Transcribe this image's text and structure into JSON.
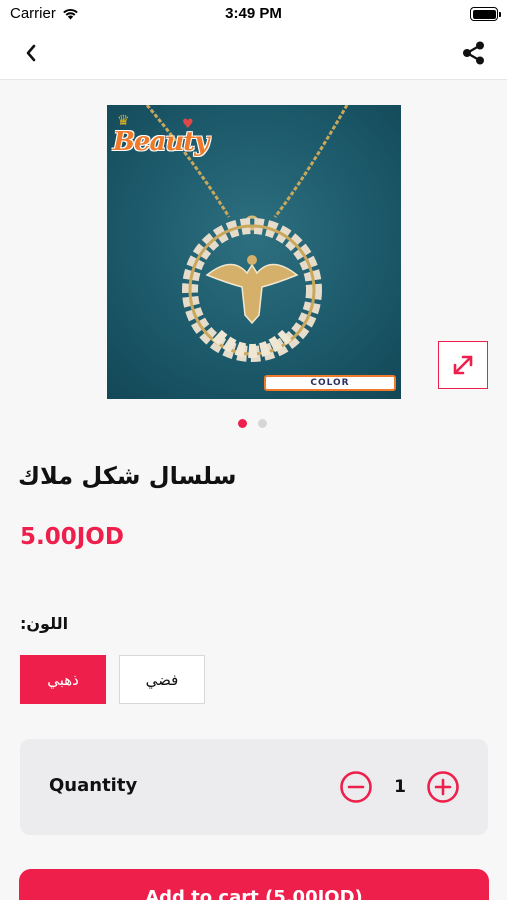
{
  "status_bar": {
    "carrier": "Carrier",
    "time": "3:49 PM"
  },
  "nav": {
    "back_icon": "chevron-left-icon",
    "share_icon": "share-icon"
  },
  "product": {
    "image_brand": "Beauty",
    "image_badge": "COLOR",
    "image_count": 2,
    "active_image_index": 0,
    "title": "سلسال شكل ملاك",
    "price": "5.00JOD"
  },
  "color": {
    "label": "اللون:",
    "options": [
      {
        "label": "ذهبي",
        "selected": true
      },
      {
        "label": "فضي",
        "selected": false
      }
    ]
  },
  "quantity": {
    "label": "Quantity",
    "value": "1"
  },
  "cart": {
    "button_label": "Add to cart (5.00JOD)"
  },
  "colors": {
    "accent": "#ee1f4b",
    "card_background": "#ececef"
  }
}
